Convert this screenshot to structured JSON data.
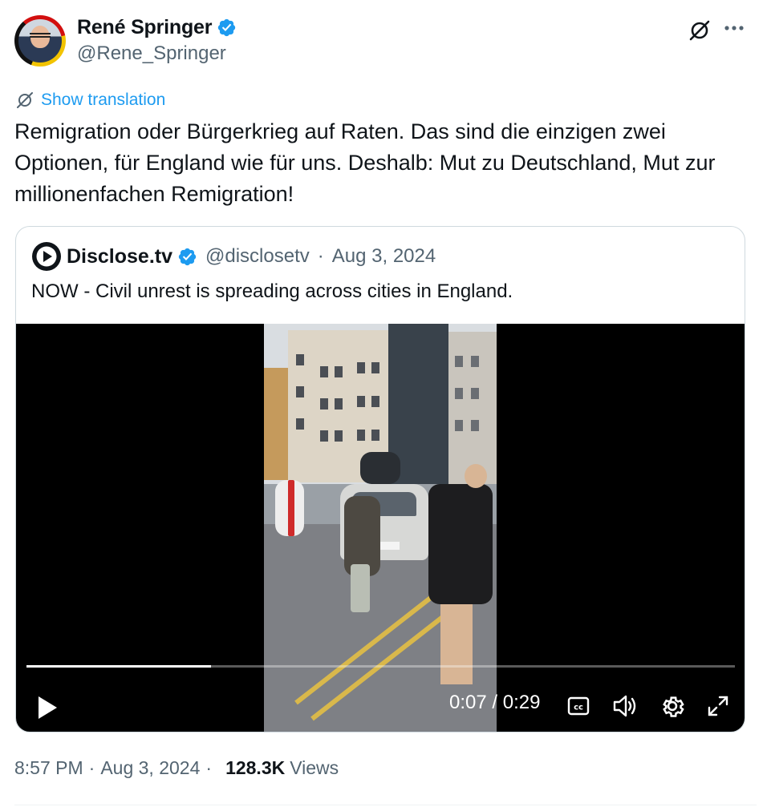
{
  "author": {
    "name": "René Springer",
    "handle": "@Rene_Springer",
    "verified": true
  },
  "header_icons": [
    "grok-icon",
    "more-icon"
  ],
  "translation": {
    "label": "Show translation"
  },
  "tweet_text": "Remigration oder Bürgerkrieg auf Raten. Das sind die einzigen zwei\nOptionen, für England wie für uns. Deshalb: Mut zu Deutschland, Mut zur\nmillionenfachen Remigration!",
  "quote": {
    "name": "Disclose.tv",
    "handle": "@disclosetv",
    "separator": "·",
    "date": "Aug 3, 2024",
    "text": "NOW - Civil unrest is spreading across cities in England."
  },
  "video": {
    "current_time": "0:07",
    "duration": "0:29",
    "time_display": "0:07 / 0:29",
    "progress_fraction": 0.26,
    "controls": [
      "play-icon",
      "captions-icon",
      "volume-icon",
      "settings-icon",
      "fullscreen-icon"
    ]
  },
  "footer": {
    "time": "8:57 PM",
    "separator": "·",
    "date": "Aug 3, 2024",
    "views_count": "128.3K",
    "views_label": "Views"
  },
  "colors": {
    "accent": "#1d9bf0",
    "secondary_text": "#536471",
    "primary_text": "#0f1419",
    "border": "#cfd9de"
  }
}
